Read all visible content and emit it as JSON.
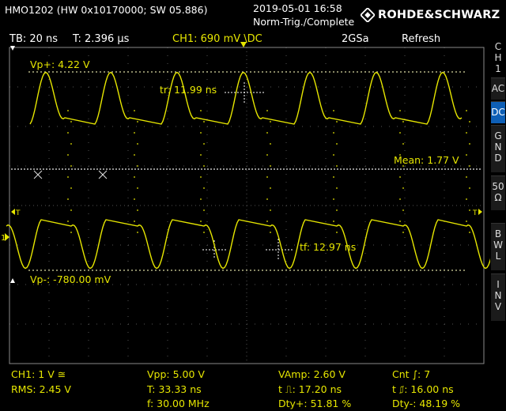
{
  "header": {
    "model": "HMO1202 (HW 0x10170000; SW 05.886)",
    "datetime": "2019-05-01 16:58",
    "trigger_status": "Norm-Trig./Complete",
    "brand": "ROHDE&SCHWARZ"
  },
  "infobar": {
    "timebase": "TB: 20 ns",
    "trigger_time": "T: 2.396 µs",
    "channel_setting": "CH1: 690 mV \\DC",
    "sample_rate": "2GSa",
    "mode": "Refresh"
  },
  "sidebar": {
    "items": [
      {
        "label": "C\nH\n1",
        "active": false
      },
      {
        "label": "AC",
        "active": false
      },
      {
        "label": "DC",
        "active": true
      },
      {
        "label": "G\nN\nD",
        "active": false
      },
      {
        "label": "50\nΩ",
        "active": false
      },
      {
        "label": "B\nW\nL",
        "active": false
      },
      {
        "label": "I\nN\nV",
        "active": false
      }
    ]
  },
  "cursors": {
    "vp_plus": "Vp+: 4.22 V",
    "mean": "Mean: 1.77 V",
    "vp_minus": "Vp-: -780.00 mV",
    "rise_time": "tr: 11.99 ns",
    "fall_time": "tf: 12.97 ns"
  },
  "markers": {
    "trigger_pos": "T",
    "level_left": "T",
    "level_right": "T",
    "ground": "1"
  },
  "measurements": {
    "channel": "CH1: 1 V ≅",
    "rms": "RMS: 2.45 V",
    "vpp": "Vpp: 5.00 V",
    "period": "T: 33.33 ns",
    "frequency": "f: 30.00 MHz",
    "vamp": "VAmp: 2.60 V",
    "pos_width": "t ⎍: 17.20 ns",
    "duty_pos": "Dty+: 51.81 %",
    "count": "Cnt ∫: 7",
    "neg_width": "t ⎎: 16.00 ns",
    "duty_neg": "Dty-: 48.19 %"
  },
  "colors": {
    "trace": "#e6e600",
    "grid": "#5a5a5a",
    "active_button": "#0e5fb6",
    "text": "#ffffff"
  }
}
